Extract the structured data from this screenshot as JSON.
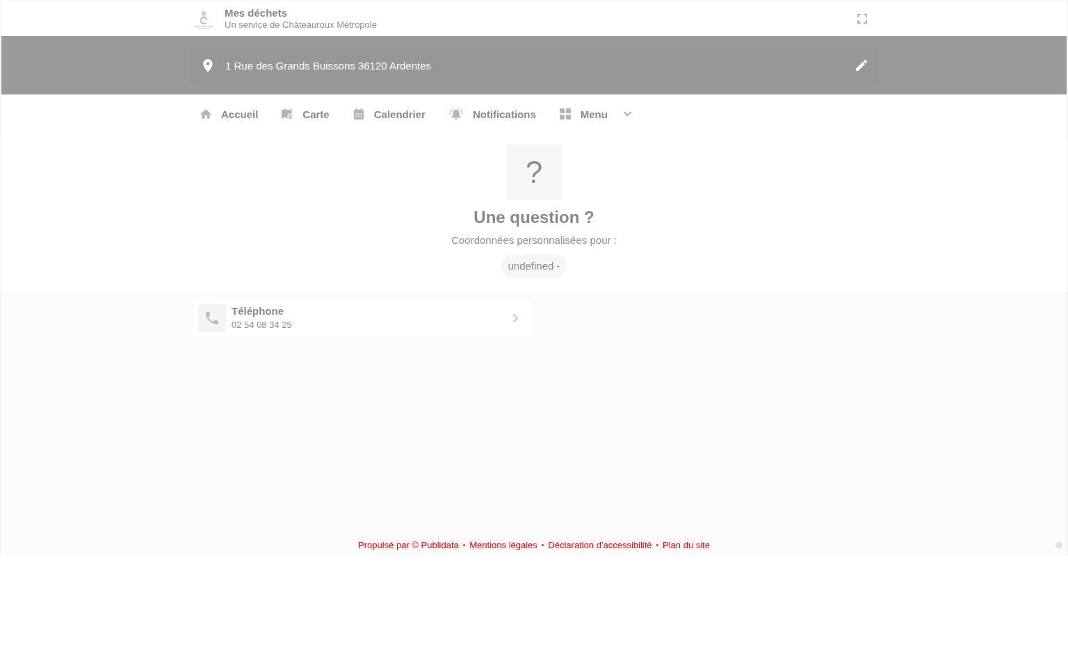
{
  "header": {
    "title": "Mes déchets",
    "subtitle": "Un service de Châteauroux Métropole"
  },
  "address": {
    "value": "1 Rue des Grands Buissons 36120 Ardentes"
  },
  "nav": {
    "items": [
      {
        "label": "Accueil"
      },
      {
        "label": "Carte"
      },
      {
        "label": "Calendrier"
      },
      {
        "label": "Notifications"
      }
    ],
    "menu": {
      "label": "Menu",
      "expanded": false
    }
  },
  "question": {
    "icon": "?",
    "title": "Une question ?",
    "subtitle": "Coordonnées personnalisées pour :",
    "tag": "undefined -"
  },
  "contacts": [
    {
      "label": "Téléphone",
      "value": "02 54 08 34 25"
    }
  ],
  "footer": {
    "items": [
      {
        "kind": "link",
        "text": "Propulsé par © Publidata"
      },
      {
        "kind": "separator",
        "text": "•"
      },
      {
        "kind": "link",
        "text": "Mentions légales"
      },
      {
        "kind": "separator",
        "text": "•"
      },
      {
        "kind": "link",
        "text": "Déclaration d'accessibilité"
      },
      {
        "kind": "separator",
        "text": "•"
      },
      {
        "kind": "link",
        "text": "Plan du site"
      }
    ]
  }
}
